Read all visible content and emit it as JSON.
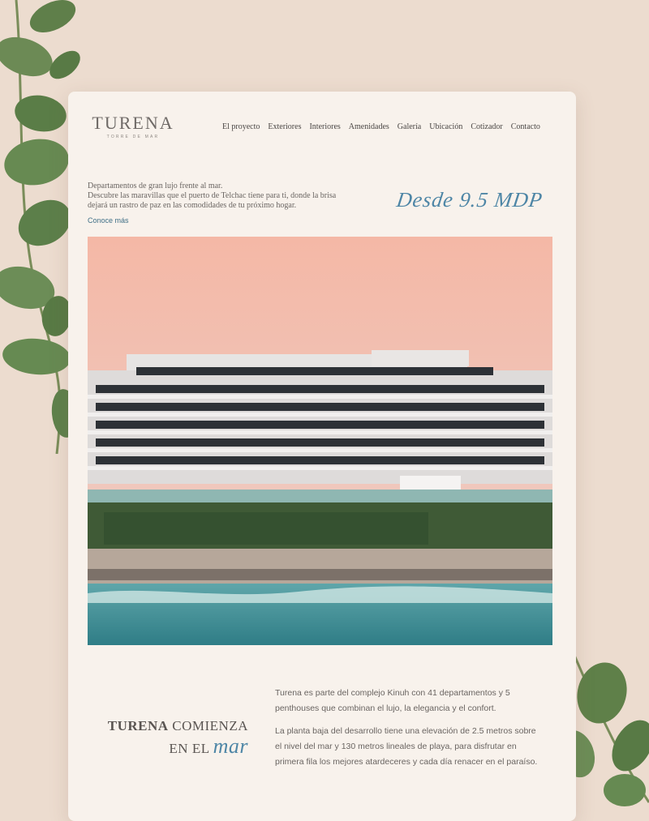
{
  "brand": {
    "name": "TURENA",
    "tagline": "TORRE DE MAR"
  },
  "nav": {
    "items": [
      "El proyecto",
      "Exteriores",
      "Interiores",
      "Amenidades",
      "Galería",
      "Ubicación",
      "Cotizador",
      "Contacto"
    ]
  },
  "hero": {
    "line1": "Departamentos de gran lujo frente al mar.",
    "line2": "Descubre las maravillas que el puerto de Telchac tiene para ti, donde la brisa",
    "line3": "dejará un rastro de paz en las comodidades de tu próximo hogar.",
    "link": "Conoce más",
    "price": "Desde 9.5 MDP"
  },
  "section": {
    "title_bold": "TURENA",
    "title_rest": " COMIENZA",
    "title_line2": "EN EL",
    "title_accent": "mar",
    "para1": "Turena es parte del complejo Kinuh con 41 departamentos y 5 penthouses que combinan el lujo, la elegancia y el confort.",
    "para2": "La planta baja del desarrollo tiene una elevación de 2.5 metros sobre el nivel del mar y 130 metros lineales de playa, para disfrutar en primera fila los mejores atardeceres y cada día renacer en el paraíso."
  },
  "colors": {
    "accent": "#4e86a6",
    "card": "#f8f2ec",
    "background": "#ecdccf",
    "text": "#6a6562"
  }
}
